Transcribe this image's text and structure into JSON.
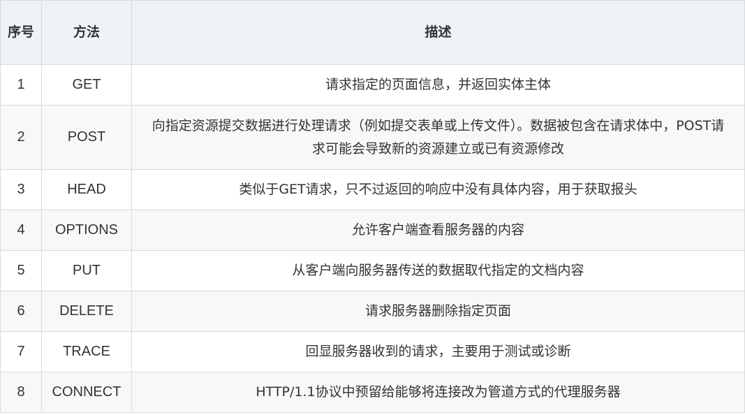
{
  "header": {
    "num": "序号",
    "method": "方法",
    "desc": "描述"
  },
  "rows": [
    {
      "num": "1",
      "method": "GET",
      "desc": "请求指定的页面信息，并返回实体主体"
    },
    {
      "num": "2",
      "method": "POST",
      "desc": "向指定资源提交数据进行处理请求（例如提交表单或上传文件）。数据被包含在请求体中，POST请求可能会导致新的资源建立或已有资源修改"
    },
    {
      "num": "3",
      "method": "HEAD",
      "desc": "类似于GET请求，只不过返回的响应中没有具体内容，用于获取报头"
    },
    {
      "num": "4",
      "method": "OPTIONS",
      "desc": "允许客户端查看服务器的内容"
    },
    {
      "num": "5",
      "method": "PUT",
      "desc": "从客户端向服务器传送的数据取代指定的文档内容"
    },
    {
      "num": "6",
      "method": "DELETE",
      "desc": "请求服务器删除指定页面"
    },
    {
      "num": "7",
      "method": "TRACE",
      "desc": "回显服务器收到的请求，主要用于测试或诊断"
    },
    {
      "num": "8",
      "method": "CONNECT",
      "desc": "HTTP/1.1协议中预留给能够将连接改为管道方式的代理服务器"
    }
  ]
}
